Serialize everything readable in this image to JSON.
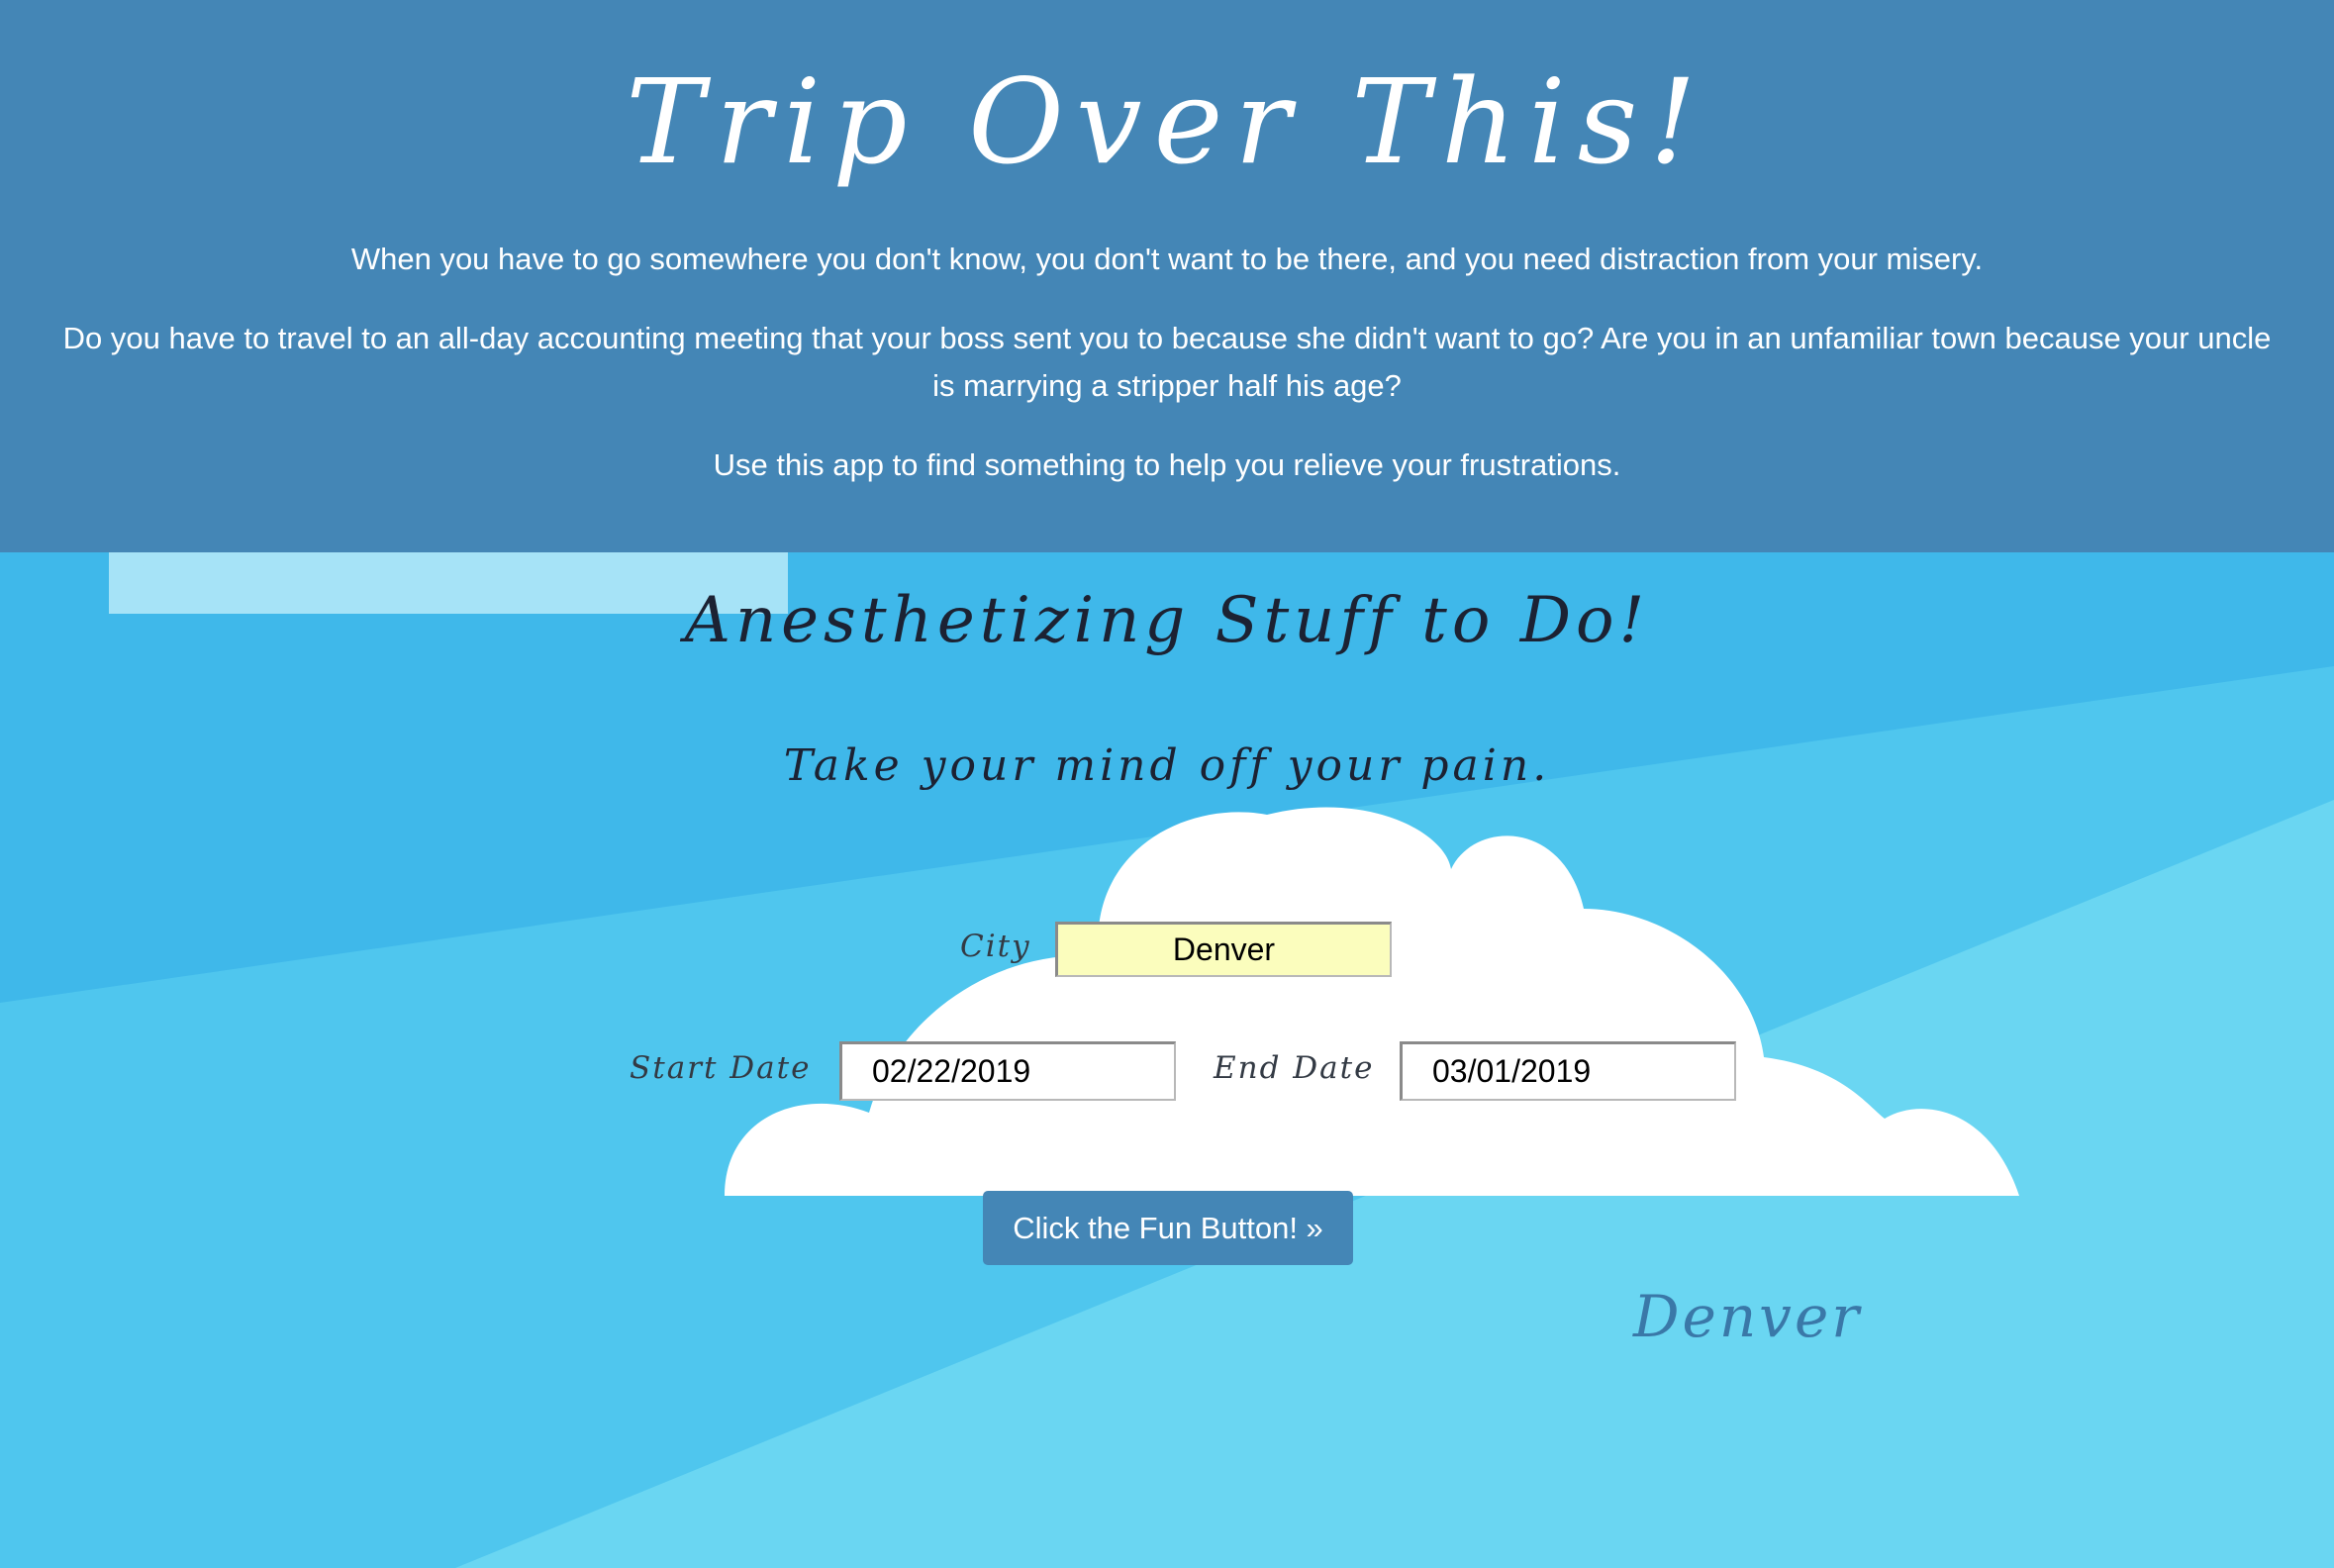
{
  "header": {
    "title": "Trip Over This!",
    "intro": [
      "When you have to go somewhere you don't know, you don't want to be there, and you need distraction from your misery.",
      "Do you have to travel to an all-day accounting meeting that your boss sent you to because she didn't want to go? Are you in an unfamiliar town because your uncle is marrying a stripper half his age?",
      "Use this app to find something to help you relieve your frustrations."
    ]
  },
  "main": {
    "title": "Anesthetizing Stuff to Do!",
    "tagline": "Take your mind off your pain."
  },
  "form": {
    "city_label": "City",
    "city_value": "Denver",
    "start_label": "Start Date",
    "start_value": "02/22/2019",
    "end_label": "End Date",
    "end_value": "03/01/2019",
    "button_label": "Click the Fun Button! »"
  },
  "result": {
    "city": "Denver"
  },
  "colors": {
    "header_bg": "#4486b6",
    "sky_light": "#6ad6f2",
    "sky_mid": "#4fc6ee",
    "sky_dark": "#3fb8ea",
    "city_field_bg": "#fbfdbd",
    "button_bg": "#4486b6",
    "result_text": "#3a78a8"
  }
}
